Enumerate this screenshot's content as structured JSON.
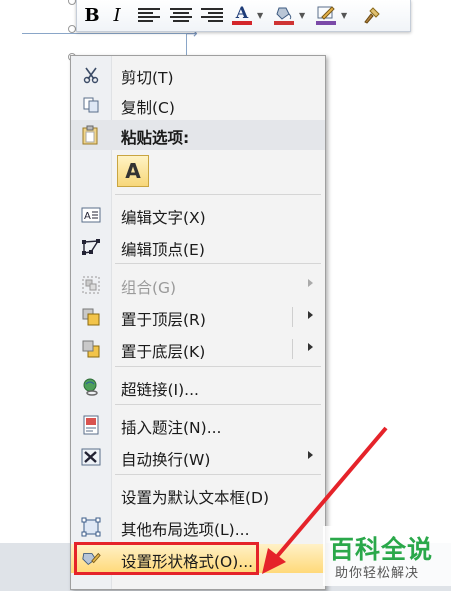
{
  "toolbar": {
    "bold": "B",
    "italic": "I",
    "font_color_glyph": "A",
    "colors": {
      "font": "#d4262b",
      "highlight": "#cf3434",
      "line": "#7b4aa8"
    }
  },
  "menu": {
    "items": [
      {
        "label": "剪切(T)",
        "icon": "scissors-icon"
      },
      {
        "label": "复制(C)",
        "icon": "copy-icon"
      },
      {
        "label": "粘贴选项:",
        "icon": "clipboard-icon"
      },
      {
        "label": "A",
        "icon": "paste-text-icon"
      },
      {
        "label": "编辑文字(X)",
        "icon": "edit-text-icon"
      },
      {
        "label": "编辑顶点(E)",
        "icon": "edit-points-icon"
      },
      {
        "label": "组合(G)",
        "icon": "group-icon",
        "disabled": true
      },
      {
        "label": "置于顶层(R)",
        "icon": "bring-front-icon"
      },
      {
        "label": "置于底层(K)",
        "icon": "send-back-icon"
      },
      {
        "label": "超链接(I)...",
        "icon": "hyperlink-icon"
      },
      {
        "label": "插入题注(N)...",
        "icon": "caption-icon"
      },
      {
        "label": "自动换行(W)",
        "icon": "wrap-text-icon"
      },
      {
        "label": "设置为默认文本框(D)",
        "icon": ""
      },
      {
        "label": "其他布局选项(L)...",
        "icon": "layout-options-icon"
      },
      {
        "label": "设置形状格式(O)...",
        "icon": "format-shape-icon"
      }
    ]
  },
  "watermark": {
    "title": "百科全说",
    "subtitle": "助你轻松解决"
  },
  "colors": {
    "highlight": "#ffd979",
    "annotation": "#e5232a",
    "watermark": "#2aa84a"
  }
}
